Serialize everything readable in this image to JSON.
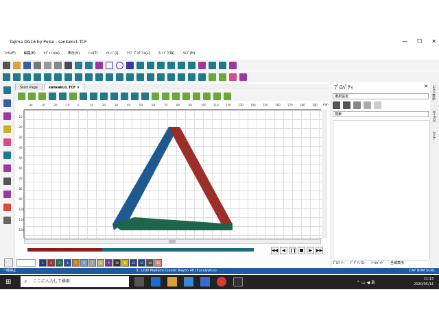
{
  "window": {
    "title": "Tajima DG16 by Pulse - sankaku1.TCF",
    "min": "—",
    "max": "☐",
    "close": "✕"
  },
  "menu": [
    "ﾌｧｲﾙ(F)",
    "編集(E)",
    "ｾｸﾞﾒﾝﾄ(w)",
    "表示(V)",
    "ﾂｰﾙ(T)",
    "ｲﾒｰｼﾞ(I)",
    "ﾗｲﾌﾞﾌﾟﾛｸﾞﾗﾑ(L)",
    "ｳｨﾝﾄﾞｳ(W)",
    "ﾍﾙﾌﾟ(H)"
  ],
  "tabs": [
    {
      "label": "Start Page",
      "active": false
    },
    {
      "label": "sankaku1.TCF",
      "active": true,
      "close": "×"
    }
  ],
  "ruler": {
    "h_ticks": [
      "-40",
      "-30",
      "-20",
      "-10",
      "0",
      "10",
      "20",
      "30",
      "40",
      "50",
      "60",
      "70",
      "80",
      "90",
      "100",
      "110",
      "120",
      "130",
      "140",
      "150",
      "160",
      "170",
      "180",
      "190"
    ],
    "v_ticks": [
      "-10",
      "-20",
      "-30",
      "-40",
      "-50",
      "-60",
      "-70",
      "-80",
      "-90",
      "-100",
      "-110",
      "-120"
    ],
    "unit": "mm"
  },
  "design": {
    "colors": {
      "left": "#1f5d96",
      "right": "#a3302a",
      "bottom": "#1f6b4c"
    }
  },
  "progress": {
    "red_fraction": 0.33
  },
  "playback": [
    "◀◀",
    "◀",
    "❙❙",
    "■",
    "▶",
    "▶▶"
  ],
  "colorbar": [
    {
      "n": "1",
      "c": "#1f3d7a"
    },
    {
      "n": "2",
      "c": "#a3302a"
    },
    {
      "n": "3",
      "c": "#1f6b4c"
    },
    {
      "n": "4",
      "c": "#2b4aa8"
    },
    {
      "n": "5",
      "c": "#c87f2a"
    },
    {
      "n": "6",
      "c": "#6fa0c8"
    },
    {
      "n": "7",
      "c": "#a0a0a0"
    },
    {
      "n": "8",
      "c": "#c8b070"
    },
    {
      "n": "9",
      "c": "#6a3a8a"
    },
    {
      "n": "10",
      "c": "#333333"
    },
    {
      "n": "11",
      "c": "#c8b020"
    },
    {
      "n": "12",
      "c": "#2a3a8a"
    },
    {
      "n": "13",
      "c": "#1f3d7a"
    },
    {
      "n": "14",
      "c": "#4a4a4a"
    },
    {
      "n": "15",
      "c": "#e08080"
    }
  ],
  "properties": {
    "title": "ﾌﾟﾛﾊﾟﾃｨ",
    "close": "✕",
    "select": "選択設定",
    "search_placeholder": "検索",
    "tabs": [
      "ﾌﾟﾛﾊﾟﾃｨ",
      "ﾃﾞｻﾞｲﾝﾌﾛｰ",
      "ﾂｰﾙｶﾞｲﾄﾞ",
      "全域表示"
    ]
  },
  "sidetabs": [
    "ｴﾚﾒﾝﾄ表示",
    "ｽﾃｯﾁﾘｽﾄ",
    "ｽｷｬﾅｰ"
  ],
  "status": {
    "left": "一時停止",
    "middle": "3: 1290 Madeira Classic Rayon 40 (Eucalyptus)",
    "right": "CAP  NUM  SCRL"
  },
  "taskbar": {
    "search_placeholder": "ここに入力して検索",
    "time": "11:13",
    "date": "2020/05/14"
  }
}
